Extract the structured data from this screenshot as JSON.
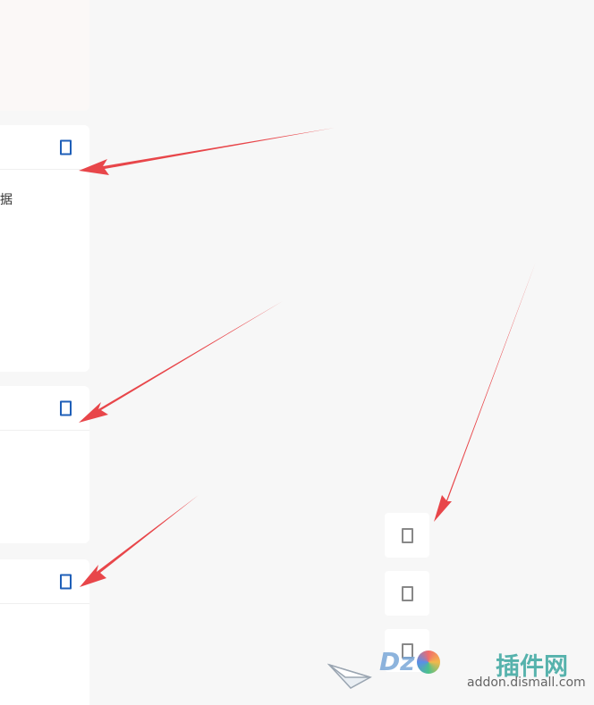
{
  "cards": [
    {
      "text": "据"
    },
    {
      "text": ""
    },
    {
      "text": ""
    }
  ],
  "side_buttons": [
    "bookmark-icon",
    "bookmark-icon",
    "bookmark-icon"
  ],
  "watermark": {
    "brand": "Dz",
    "brand_tail": "插件网",
    "url": "addon.dismall.com"
  },
  "colors": {
    "arrow": "#e8464a",
    "card_icon": "#1f5fb8",
    "side_icon": "#888888",
    "background": "#f7f7f7"
  }
}
